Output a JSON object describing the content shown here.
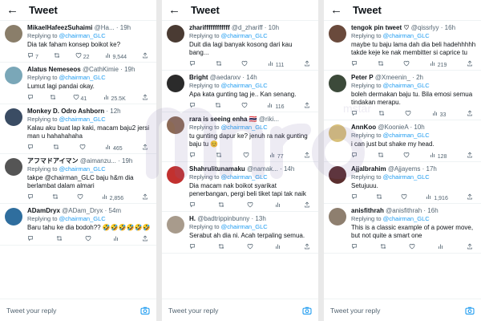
{
  "header": {
    "title": "Tweet",
    "back_icon": "arrow-left-icon"
  },
  "reply": {
    "placeholder": "Tweet your reply",
    "icon": "camera-icon"
  },
  "watermark": {
    "brand": "mstar"
  },
  "colors": {
    "link": "#1d9bf0",
    "secondary": "#536471"
  },
  "replying_label": "Replying to",
  "mention": "@chairman_GLC",
  "panels": [
    {
      "tweets": [
        {
          "name": "MikaelHafeezSuhaimi",
          "handle": "@Ha...",
          "time": "· 19h",
          "text": "Dia tak faham konsep boikot ke?",
          "replies": "7",
          "retweets": "",
          "likes": "22",
          "views": "9,544",
          "avatar": "#8a7e6a"
        },
        {
          "name": "Alatus Nemeseos",
          "handle": "@CathKimie",
          "time": "· 19h",
          "text": "Lumut lagi pandai okay.",
          "replies": "",
          "retweets": "",
          "likes": "41",
          "views": "25.5K",
          "avatar": "#7aa7b8"
        },
        {
          "name": "Monkey D. Odro Ashborn",
          "handle": "",
          "time": "· 12h",
          "text": "Kalau aku buat lap kaki, macam baju2 jersi man u hahahahaha",
          "replies": "",
          "retweets": "",
          "likes": "",
          "views": "465",
          "avatar": "#3a4c63"
        },
        {
          "name": "アフマドアイマン",
          "handle": "@aimanzu...",
          "time": "· 19h",
          "text": "takpe @chairman_GLC baju h&m dia berlambat dalam almari",
          "replies": "",
          "retweets": "",
          "likes": "",
          "views": "2,856",
          "avatar": "#555555"
        },
        {
          "name": "ADamDryx",
          "handle": "@ADam_Dryx",
          "time": "· 54m",
          "text": "Baru tahu ke dia bodoh?? 🤣🤣🤣🤣🤣🤣",
          "replies": "",
          "retweets": "",
          "likes": "",
          "views": "",
          "avatar": "#2f6e9e"
        }
      ]
    },
    {
      "tweets": [
        {
          "name": "zhariffffffffffff",
          "handle": "@d_zhariff",
          "time": "· 10h",
          "text": "Duit dia lagi banyak kosong dari kau bang...",
          "replies": "",
          "retweets": "",
          "likes": "",
          "views": "111",
          "avatar": "#4a3b33"
        },
        {
          "name": "Bright",
          "handle": "@aedanxv",
          "time": "· 14h",
          "text": "Apa kata gunting tag je.. Kan senang.",
          "replies": "",
          "retweets": "",
          "likes": "",
          "views": "116",
          "avatar": "#2b2b2b"
        },
        {
          "name": "rara is seeing enha 🇹🇭",
          "handle": "@riki...",
          "time": "",
          "text": "tu gunting dapur ke? jenuh ra nak gunting baju tu 😊",
          "replies": "",
          "retweets": "",
          "likes": "",
          "views": "77",
          "avatar": "#8c6a55"
        },
        {
          "name": "Shahrulitunamaku",
          "handle": "@namak...",
          "time": "· 14h",
          "text": "Dia macam nak boikot syarikat penerbangan, pergi beli tiket tapi tak naik",
          "replies": "",
          "retweets": "",
          "likes": "",
          "views": "",
          "avatar": "#c2312f"
        },
        {
          "name": "H.",
          "handle": "@badtrippinbunny",
          "time": "· 13h",
          "text": "Serabut ah dia ni. Acah terpaling semua.",
          "replies": "",
          "retweets": "",
          "likes": "",
          "views": "",
          "avatar": "#a89b8c"
        }
      ]
    },
    {
      "tweets": [
        {
          "name": "tengok pin tweet ♡",
          "handle": "@qissrlyy",
          "time": "· 16h",
          "text": "maybe tu baju lama dah dia beli hadehhhhh takde keje ke nak membitter si caprice tu",
          "replies": "",
          "retweets": "",
          "likes": "",
          "views": "219",
          "avatar": "#6a4a3c"
        },
        {
          "name": "Peter P",
          "handle": "@Xmeenin_",
          "time": "· 2h",
          "text": "boleh dermakan baju tu. Bila emosi semua tindakan merapu.",
          "replies": "",
          "retweets": "",
          "likes": "",
          "views": "33",
          "avatar": "#3c4a3a"
        },
        {
          "name": "AnnKoo",
          "handle": "@KoonieA",
          "time": "· 10h",
          "text": "i can just but shake my head.",
          "replies": "",
          "retweets": "",
          "likes": "",
          "views": "128",
          "avatar": "#d8c07a"
        },
        {
          "name": "Ajjalbrahim",
          "handle": "@Ajjayems",
          "time": "· 17h",
          "text": "Setujuuu.",
          "replies": "",
          "retweets": "",
          "likes": "",
          "views": "1,916",
          "avatar": "#5a2e2e"
        },
        {
          "name": "anisfithrah",
          "handle": "@anisfithrah",
          "time": "· 16h",
          "text": "This is a classic example of a power move, but not quite a smart one",
          "replies": "",
          "retweets": "",
          "likes": "",
          "views": "",
          "avatar": "#8e7f6f"
        }
      ]
    }
  ]
}
